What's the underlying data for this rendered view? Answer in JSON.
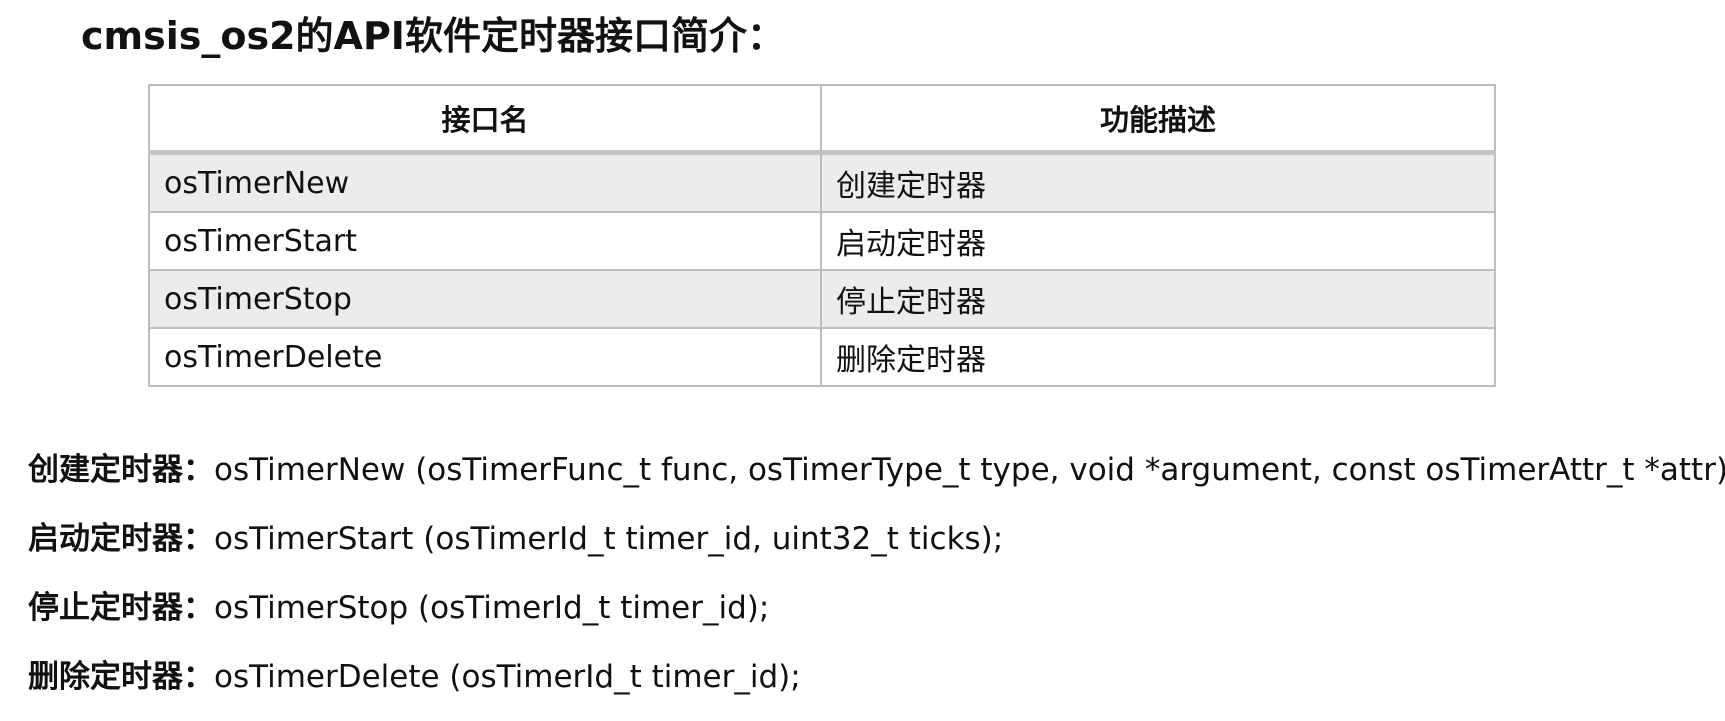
{
  "page": {
    "title": "cmsis_os2的API软件定时器接口简介："
  },
  "table": {
    "headers": [
      "接口名",
      "功能描述"
    ],
    "rows": [
      {
        "name": "osTimerNew",
        "desc": "创建定时器"
      },
      {
        "name": "osTimerStart",
        "desc": "启动定时器"
      },
      {
        "name": "osTimerStop",
        "desc": "停止定时器"
      },
      {
        "name": "osTimerDelete",
        "desc": "删除定时器"
      }
    ]
  },
  "signatures": [
    {
      "label": "创建定时器：",
      "code": "osTimerNew (osTimerFunc_t func, osTimerType_t type, void *argument, const osTimerAttr_t *attr);"
    },
    {
      "label": "启动定时器：",
      "code": "osTimerStart (osTimerId_t timer_id, uint32_t ticks);"
    },
    {
      "label": "停止定时器：",
      "code": "osTimerStop (osTimerId_t timer_id);"
    },
    {
      "label": "删除定时器：",
      "code": "osTimerDelete (osTimerId_t timer_id);"
    }
  ],
  "colors": {
    "text": "#111111",
    "table_border": "#bdbdbd",
    "row_stripe": "#ececec"
  }
}
